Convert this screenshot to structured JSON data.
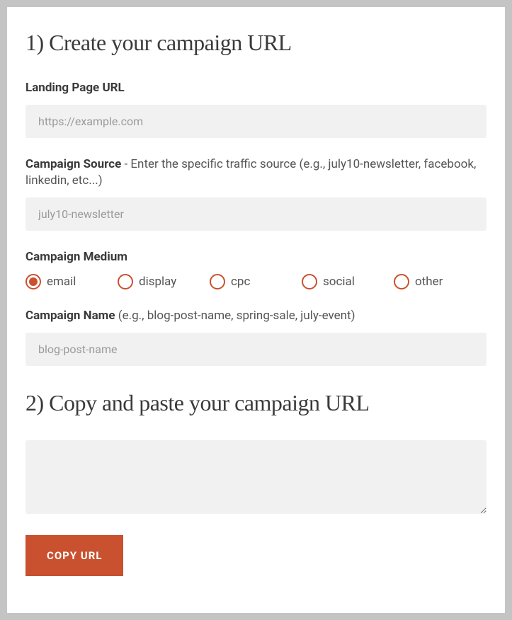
{
  "section1": {
    "heading": "1) Create your campaign URL",
    "landing": {
      "label": "Landing Page URL",
      "placeholder": "https://example.com",
      "value": ""
    },
    "source": {
      "label_strong": "Campaign Source",
      "label_rest": " - Enter the specific traffic source (e.g., july10-newsletter, facebook, linkedin, etc...)",
      "placeholder": "july10-newsletter",
      "value": ""
    },
    "medium": {
      "label": "Campaign Medium",
      "options": [
        {
          "label": "email",
          "selected": true
        },
        {
          "label": "display",
          "selected": false
        },
        {
          "label": "cpc",
          "selected": false
        },
        {
          "label": "social",
          "selected": false
        },
        {
          "label": "other",
          "selected": false
        }
      ]
    },
    "name": {
      "label_strong": "Campaign Name",
      "label_rest": " (e.g., blog-post-name, spring-sale, july-event)",
      "placeholder": "blog-post-name",
      "value": ""
    }
  },
  "section2": {
    "heading": "2) Copy and paste your campaign URL",
    "output": "",
    "copy_button": "Copy URL"
  },
  "colors": {
    "accent": "#c9512f",
    "input_bg": "#f1f1f1",
    "text": "#3a3a3a"
  }
}
